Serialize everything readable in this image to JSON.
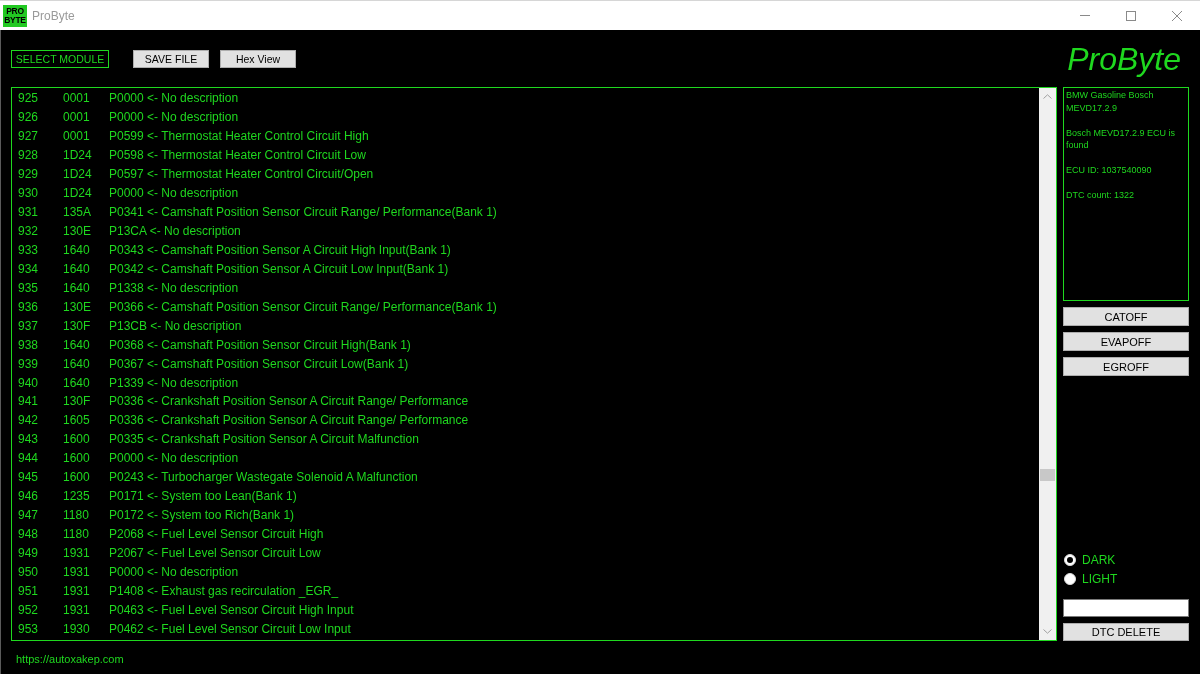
{
  "window": {
    "title": "ProByte",
    "icon_text": [
      "PRO",
      "BYTE"
    ]
  },
  "toolbar": {
    "buttons": [
      {
        "label": "SELECT MODULE",
        "kind": "outlined"
      },
      {
        "label": "SAVE FILE",
        "kind": "plain"
      },
      {
        "label": "Hex View",
        "kind": "plain"
      }
    ]
  },
  "logo": "ProByte",
  "dtc_list": {
    "rows": [
      {
        "number": "925",
        "hex": "0001",
        "dtc": "P0000 <- No description"
      },
      {
        "number": "926",
        "hex": "0001",
        "dtc": "P0000 <- No description"
      },
      {
        "number": "927",
        "hex": "0001",
        "dtc": "P0599 <- Thermostat Heater Control Circuit High"
      },
      {
        "number": "928",
        "hex": "1D24",
        "dtc": "P0598 <- Thermostat Heater Control Circuit Low"
      },
      {
        "number": "929",
        "hex": "1D24",
        "dtc": "P0597 <- Thermostat Heater Control Circuit/Open"
      },
      {
        "number": "930",
        "hex": "1D24",
        "dtc": "P0000 <- No description"
      },
      {
        "number": "931",
        "hex": "135A",
        "dtc": "P0341 <- Camshaft Position Sensor Circuit Range/ Performance(Bank 1)"
      },
      {
        "number": "932",
        "hex": "130E",
        "dtc": "P13CA <- No description"
      },
      {
        "number": "933",
        "hex": "1640",
        "dtc": "P0343 <- Camshaft Position Sensor A Circuit High Input(Bank 1)"
      },
      {
        "number": "934",
        "hex": "1640",
        "dtc": "P0342 <- Camshaft Position Sensor A Circuit Low Input(Bank 1)"
      },
      {
        "number": "935",
        "hex": "1640",
        "dtc": "P1338 <- No description"
      },
      {
        "number": "936",
        "hex": "130E",
        "dtc": "P0366 <- Camshaft Position Sensor Circuit Range/ Performance(Bank 1)"
      },
      {
        "number": "937",
        "hex": "130F",
        "dtc": "P13CB <- No description"
      },
      {
        "number": "938",
        "hex": "1640",
        "dtc": "P0368 <- Camshaft Position Sensor Circuit High(Bank 1)"
      },
      {
        "number": "939",
        "hex": "1640",
        "dtc": "P0367 <- Camshaft Position Sensor Circuit Low(Bank 1)"
      },
      {
        "number": "940",
        "hex": "1640",
        "dtc": "P1339 <- No description"
      },
      {
        "number": "941",
        "hex": "130F",
        "dtc": "P0336 <- Crankshaft Position Sensor A Circuit Range/ Performance"
      },
      {
        "number": "942",
        "hex": "1605",
        "dtc": "P0336 <- Crankshaft Position Sensor A Circuit Range/ Performance"
      },
      {
        "number": "943",
        "hex": "1600",
        "dtc": "P0335 <- Crankshaft Position Sensor A Circuit Malfunction"
      },
      {
        "number": "944",
        "hex": "1600",
        "dtc": "P0000 <- No description"
      },
      {
        "number": "945",
        "hex": "1600",
        "dtc": "P0243 <- Turbocharger Wastegate Solenoid A Malfunction"
      },
      {
        "number": "946",
        "hex": "1235",
        "dtc": "P0171 <- System too Lean(Bank 1)"
      },
      {
        "number": "947",
        "hex": "1180",
        "dtc": "P0172 <- System too Rich(Bank 1)"
      },
      {
        "number": "948",
        "hex": "1180",
        "dtc": "P2068 <- Fuel Level Sensor Circuit High"
      },
      {
        "number": "949",
        "hex": "1931",
        "dtc": "P2067 <- Fuel Level Sensor Circuit Low"
      },
      {
        "number": "950",
        "hex": "1931",
        "dtc": "P0000 <- No description"
      },
      {
        "number": "951",
        "hex": "1931",
        "dtc": "P1408 <- Exhaust gas recirculation _EGR_"
      },
      {
        "number": "952",
        "hex": "1931",
        "dtc": "P0463 <- Fuel Level Sensor Circuit High Input"
      },
      {
        "number": "953",
        "hex": "1930",
        "dtc": "P0462 <- Fuel Level Sensor Circuit Low Input"
      }
    ]
  },
  "info_panel": {
    "lines": [
      "BMW Gasoline Bosch MEVD17.2.9",
      "Bosch MEVD17.2.9 ECU is found",
      "ECU ID: 1037540090",
      "DTC count: 1322"
    ]
  },
  "actions": [
    "CATOFF",
    "EVAPOFF",
    "EGROFF"
  ],
  "theme": [
    {
      "label": "DARK",
      "selected": true
    },
    {
      "label": "LIGHT",
      "selected": false
    }
  ],
  "delete_button": "DTC DELETE",
  "footer": {
    "url": "https://autoxakep.com"
  }
}
